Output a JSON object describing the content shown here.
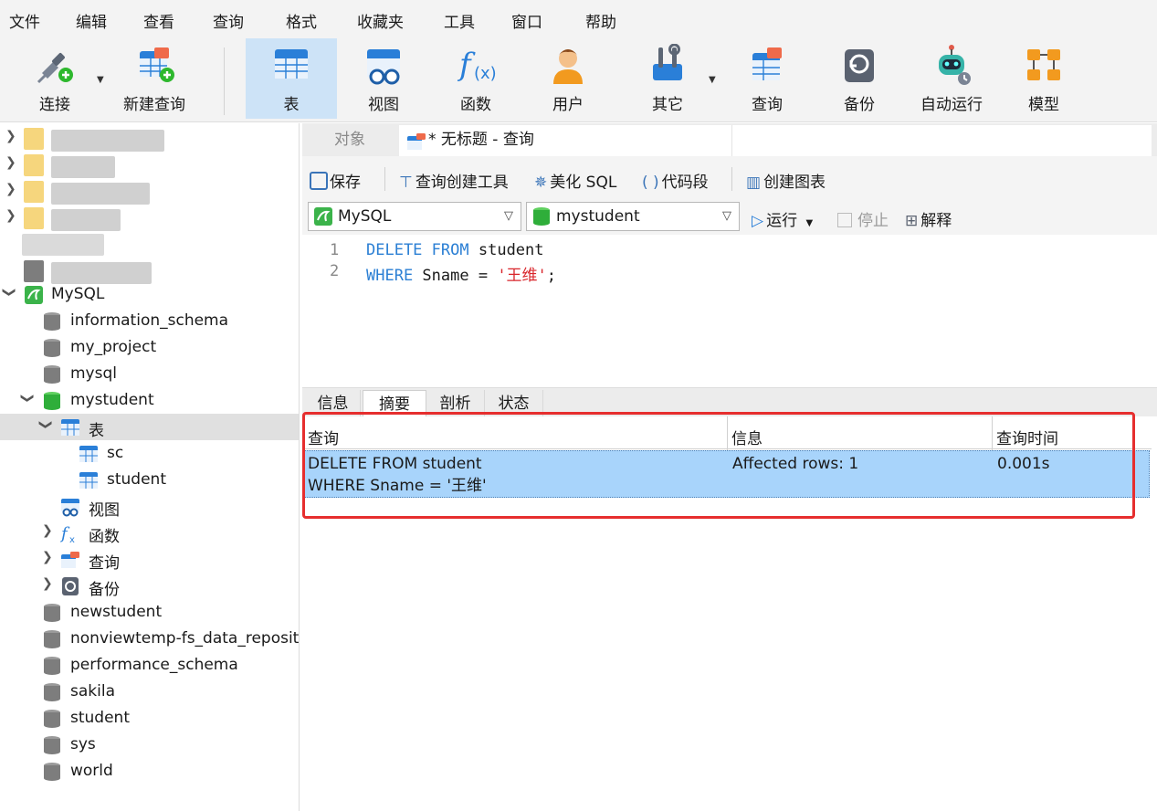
{
  "menu": [
    "文件",
    "编辑",
    "查看",
    "查询",
    "格式",
    "收藏夹",
    "工具",
    "窗口",
    "帮助"
  ],
  "toolbar": {
    "connect": "连接",
    "new_query": "新建查询",
    "table": "表",
    "view": "视图",
    "function": "函数",
    "user": "用户",
    "other": "其它",
    "query": "查询",
    "backup": "备份",
    "automation": "自动运行",
    "model": "模型"
  },
  "sidebar": {
    "connection": "MySQL",
    "databases_before": [
      "information_schema",
      "my_project",
      "mysql"
    ],
    "open_db": "mystudent",
    "tables_group": "表",
    "tables": [
      "sc",
      "student"
    ],
    "views_group": "视图",
    "functions_group": "函数",
    "queries_group": "查询",
    "backups_group": "备份",
    "databases_after": [
      "newstudent",
      "nonviewtemp-fs_data_reposit",
      "performance_schema",
      "sakila",
      "student",
      "sys",
      "world"
    ]
  },
  "tabs": {
    "objects": "对象",
    "query_tab": "* 无标题 - 查询"
  },
  "query_toolbar": {
    "save": "保存",
    "builder": "查询创建工具",
    "beautify": "美化 SQL",
    "snippet": "代码段",
    "chart": "创建图表",
    "connection_select": "MySQL",
    "database_select": "mystudent",
    "run": "运行",
    "stop": "停止",
    "explain": "解释"
  },
  "editor": {
    "line_numbers": [
      "1",
      "2"
    ],
    "line1_kw1": "DELETE",
    "line1_kw2": "FROM",
    "line1_rest": " student",
    "line2_kw": "WHERE",
    "line2_mid": " Sname = ",
    "line2_str": "'王维'",
    "line2_end": ";"
  },
  "result_tabs": [
    "信息",
    "摘要",
    "剖析",
    "状态"
  ],
  "result_grid": {
    "columns": [
      "查询",
      "信息",
      "查询时间"
    ],
    "row": {
      "query_line1": "DELETE FROM student",
      "query_line2": "WHERE Sname = '王维'",
      "info": "Affected rows: 1",
      "time": "0.001s"
    }
  },
  "colors": {
    "accent": "#cde3f7",
    "selected_row": "#a8d4fb",
    "highlight_border": "#e62e2e",
    "keyword": "#2b7fd4",
    "string": "#d9262c"
  }
}
